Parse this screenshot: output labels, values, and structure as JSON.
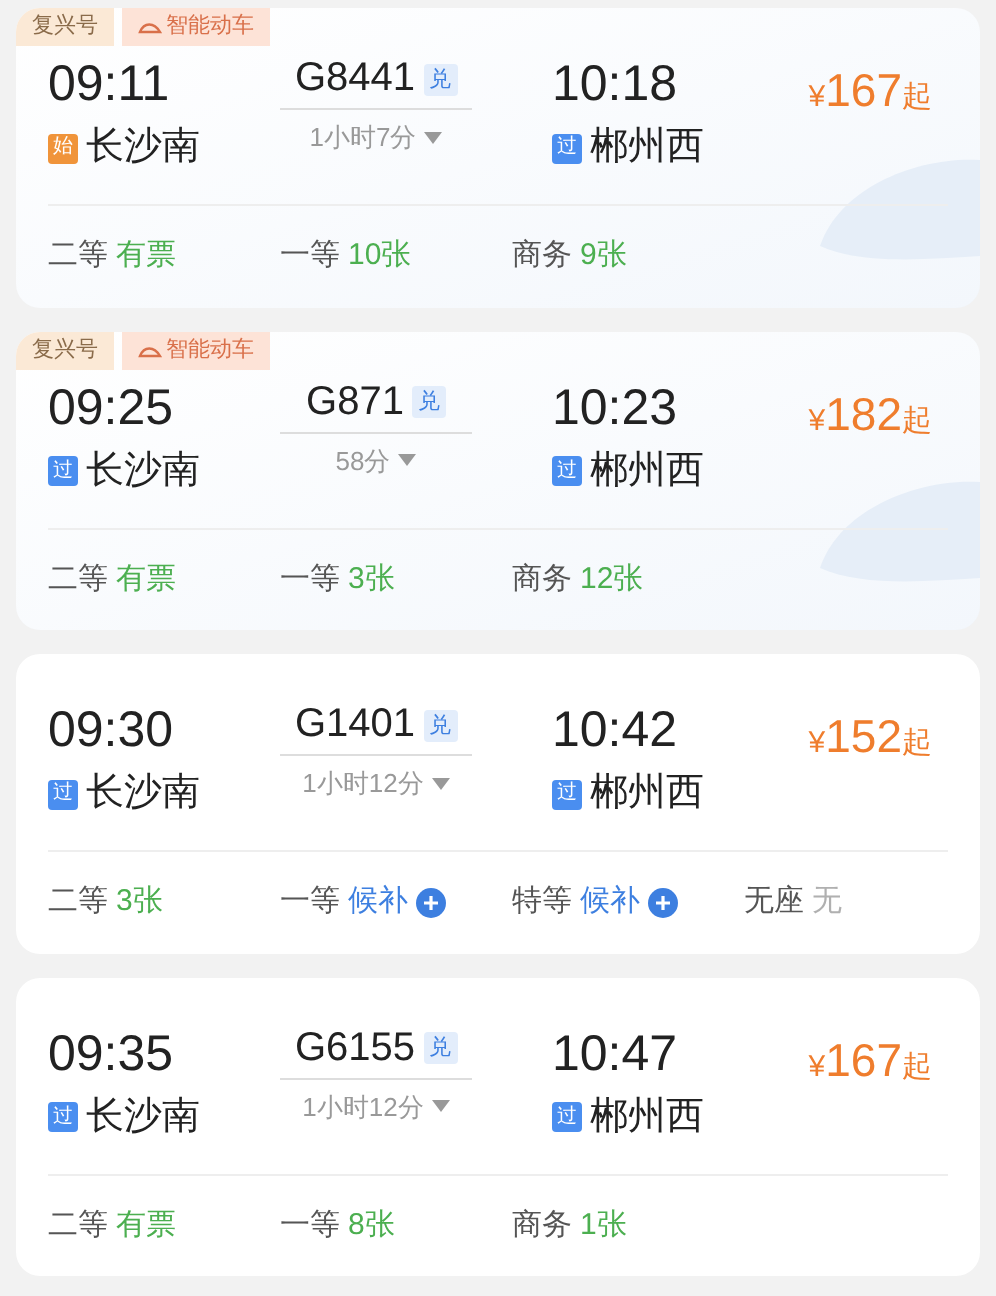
{
  "trains": [
    {
      "tags": [
        "复兴号",
        "智能动车"
      ],
      "depart": "09:11",
      "number": "G8441",
      "exchange": "兑",
      "arrive": "10:18",
      "from": {
        "badge": "始",
        "kind": "start",
        "name": "长沙南"
      },
      "duration": "1小时7分",
      "to": {
        "badge": "过",
        "kind": "pass",
        "name": "郴州西"
      },
      "price_symbol": "¥",
      "price": "167",
      "price_suffix": "起",
      "seats": [
        {
          "class": "二等",
          "status": "有票",
          "kind": "available"
        },
        {
          "class": "一等",
          "status": "10张",
          "kind": "available"
        },
        {
          "class": "商务",
          "status": "9张",
          "kind": "available"
        }
      ]
    },
    {
      "tags": [
        "复兴号",
        "智能动车"
      ],
      "depart": "09:25",
      "number": "G871",
      "exchange": "兑",
      "arrive": "10:23",
      "from": {
        "badge": "过",
        "kind": "pass",
        "name": "长沙南"
      },
      "duration": "58分",
      "to": {
        "badge": "过",
        "kind": "pass",
        "name": "郴州西"
      },
      "price_symbol": "¥",
      "price": "182",
      "price_suffix": "起",
      "seats": [
        {
          "class": "二等",
          "status": "有票",
          "kind": "available"
        },
        {
          "class": "一等",
          "status": "3张",
          "kind": "available"
        },
        {
          "class": "商务",
          "status": "12张",
          "kind": "available"
        }
      ]
    },
    {
      "depart": "09:30",
      "number": "G1401",
      "exchange": "兑",
      "arrive": "10:42",
      "from": {
        "badge": "过",
        "kind": "pass",
        "name": "长沙南"
      },
      "duration": "1小时12分",
      "to": {
        "badge": "过",
        "kind": "pass",
        "name": "郴州西"
      },
      "price_symbol": "¥",
      "price": "152",
      "price_suffix": "起",
      "seats": [
        {
          "class": "二等",
          "status": "3张",
          "kind": "available"
        },
        {
          "class": "一等",
          "status": "候补",
          "kind": "waitlist"
        },
        {
          "class": "特等",
          "status": "候补",
          "kind": "waitlist"
        },
        {
          "class": "无座",
          "status": "无",
          "kind": "none"
        }
      ]
    },
    {
      "depart": "09:35",
      "number": "G6155",
      "exchange": "兑",
      "arrive": "10:47",
      "from": {
        "badge": "过",
        "kind": "pass",
        "name": "长沙南"
      },
      "duration": "1小时12分",
      "to": {
        "badge": "过",
        "kind": "pass",
        "name": "郴州西"
      },
      "price_symbol": "¥",
      "price": "167",
      "price_suffix": "起",
      "seats": [
        {
          "class": "二等",
          "status": "有票",
          "kind": "available"
        },
        {
          "class": "一等",
          "status": "8张",
          "kind": "available"
        },
        {
          "class": "商务",
          "status": "1张",
          "kind": "available"
        }
      ]
    }
  ]
}
